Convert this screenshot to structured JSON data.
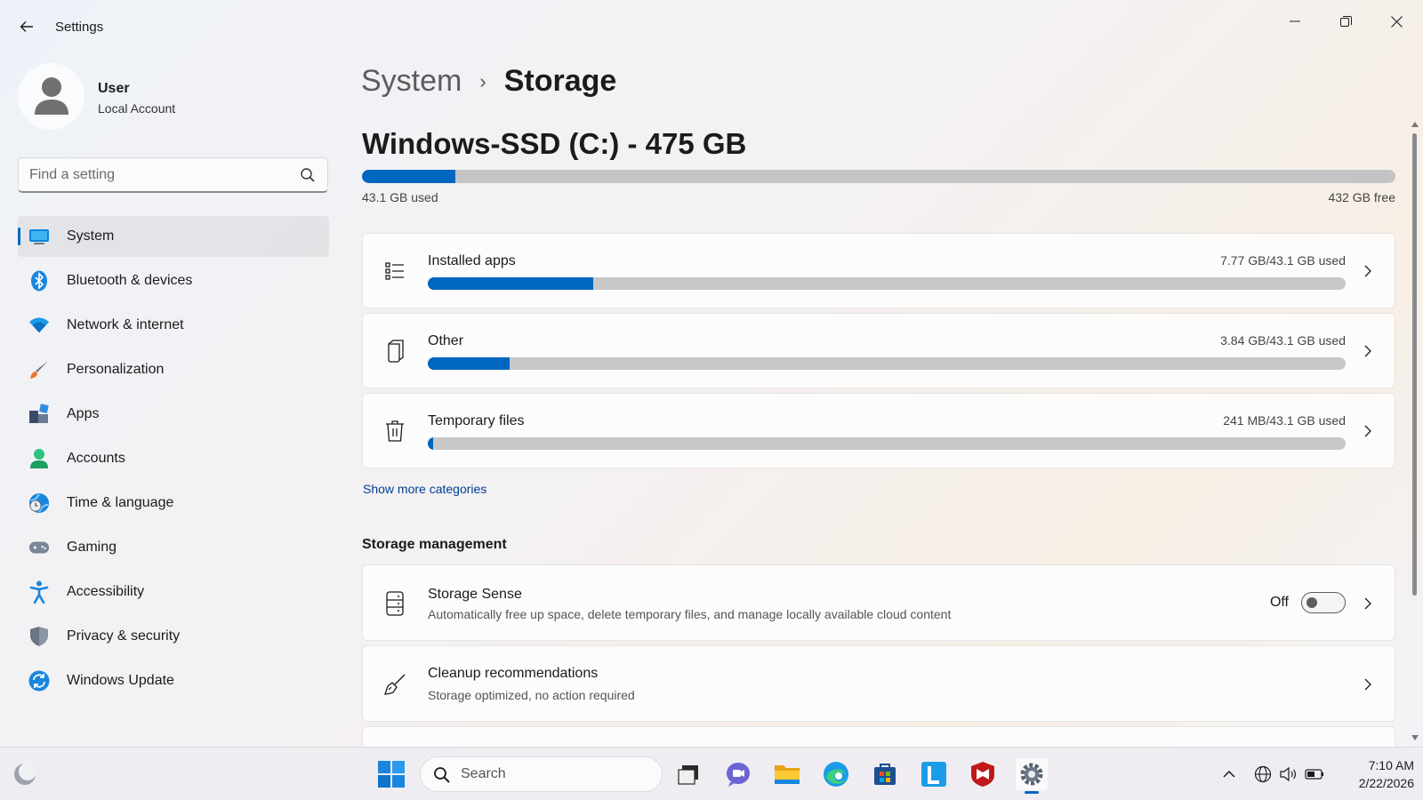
{
  "window": {
    "title": "Settings"
  },
  "profile": {
    "name": "User",
    "account_type": "Local Account"
  },
  "search": {
    "placeholder": "Find a setting"
  },
  "sidebar": {
    "items": [
      {
        "label": "System",
        "icon": "system-icon",
        "active": true
      },
      {
        "label": "Bluetooth & devices",
        "icon": "bluetooth-icon"
      },
      {
        "label": "Network & internet",
        "icon": "wifi-icon"
      },
      {
        "label": "Personalization",
        "icon": "brush-icon"
      },
      {
        "label": "Apps",
        "icon": "apps-icon"
      },
      {
        "label": "Accounts",
        "icon": "person-icon"
      },
      {
        "label": "Time & language",
        "icon": "globe-clock-icon"
      },
      {
        "label": "Gaming",
        "icon": "gamepad-icon"
      },
      {
        "label": "Accessibility",
        "icon": "accessibility-icon"
      },
      {
        "label": "Privacy & security",
        "icon": "shield-icon"
      },
      {
        "label": "Windows Update",
        "icon": "update-icon"
      }
    ]
  },
  "breadcrumb": {
    "parent": "System",
    "separator": "›",
    "current": "Storage"
  },
  "drive": {
    "title": "Windows-SSD (C:) - 475 GB",
    "used_label": "43.1 GB used",
    "free_label": "432 GB free",
    "used_fraction": 0.09
  },
  "categories": [
    {
      "title": "Installed apps",
      "value": "7.77 GB/43.1 GB used",
      "fraction": 0.18,
      "icon": "list-icon"
    },
    {
      "title": "Other",
      "value": "3.84 GB/43.1 GB used",
      "fraction": 0.089,
      "icon": "document-icon"
    },
    {
      "title": "Temporary files",
      "value": "241 MB/43.1 GB used",
      "fraction": 0.006,
      "icon": "trash-icon"
    }
  ],
  "show_more": "Show more categories",
  "storage_management": {
    "heading": "Storage management",
    "storage_sense": {
      "title": "Storage Sense",
      "description": "Automatically free up space, delete temporary files, and manage locally available cloud content",
      "toggle_label": "Off",
      "enabled": false
    },
    "cleanup": {
      "title": "Cleanup recommendations",
      "description": "Storage optimized, no action required"
    }
  },
  "taskbar": {
    "search_label": "Search",
    "time": "7:10 AM",
    "date": "2/22/2026"
  },
  "colors": {
    "accent": "#0067c0",
    "bar_track": "#c4c4c4"
  }
}
